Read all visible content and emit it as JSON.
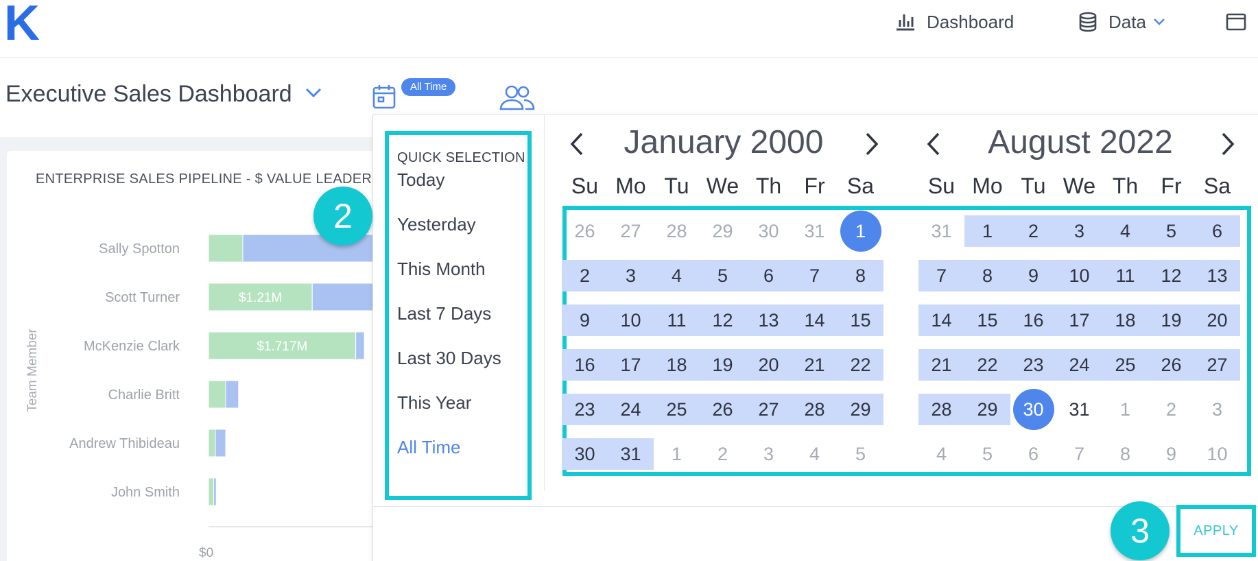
{
  "app": {
    "logo": "K"
  },
  "topnav": {
    "dashboard_label": "Dashboard",
    "data_label": "Data"
  },
  "header": {
    "title": "Executive Sales Dashboard",
    "date_filter_badge": "All Time"
  },
  "chart": {
    "title": "ENTERPRISE SALES PIPELINE - $ VALUE LEADERBO",
    "ylabel": "Team Member",
    "x_tick_0": "$0"
  },
  "chart_data": {
    "type": "bar",
    "title": "ENTERPRISE SALES PIPELINE - $ VALUE LEADERBO",
    "ylabel": "Team Member",
    "categories": [
      "Sally Spotton",
      "Scott Turner",
      "McKenzie Clark",
      "Charlie Britt",
      "Andrew Thibideau",
      "John Smith"
    ],
    "series": [
      {
        "values": [
          0.4,
          1.21,
          1.717,
          0.2,
          0.08,
          0.06
        ],
        "labels": [
          "",
          "$1.21M",
          "$1.717M",
          "",
          "",
          ""
        ]
      },
      {
        "values": [
          2.0,
          0.9,
          0.1,
          0.15,
          0.12,
          0.03
        ]
      }
    ],
    "colors": [
      "#b6e3bf",
      "#a9c2f2"
    ],
    "xlim": [
      0,
      2.4
    ]
  },
  "picker": {
    "quick_heading": "QUICK SELECTION",
    "quick_items": [
      "Today",
      "Yesterday",
      "This Month",
      "Last 7 Days",
      "Last 30 Days",
      "This Year",
      "All Time"
    ],
    "active_item": "All Time",
    "weekdays": [
      "Su",
      "Mo",
      "Tu",
      "We",
      "Th",
      "Fr",
      "Sa"
    ],
    "months": [
      {
        "title": "January 2000",
        "weeks": [
          [
            "26",
            "27",
            "28",
            "29",
            "30",
            "31",
            "1"
          ],
          [
            "2",
            "3",
            "4",
            "5",
            "6",
            "7",
            "8"
          ],
          [
            "9",
            "10",
            "11",
            "12",
            "13",
            "14",
            "15"
          ],
          [
            "16",
            "17",
            "18",
            "19",
            "20",
            "21",
            "22"
          ],
          [
            "23",
            "24",
            "25",
            "26",
            "27",
            "28",
            "29"
          ],
          [
            "30",
            "31",
            "1",
            "2",
            "3",
            "4",
            "5"
          ]
        ]
      },
      {
        "title": "August 2022",
        "weeks": [
          [
            "31",
            "1",
            "2",
            "3",
            "4",
            "5",
            "6"
          ],
          [
            "7",
            "8",
            "9",
            "10",
            "11",
            "12",
            "13"
          ],
          [
            "14",
            "15",
            "16",
            "17",
            "18",
            "19",
            "20"
          ],
          [
            "21",
            "22",
            "23",
            "24",
            "25",
            "26",
            "27"
          ],
          [
            "28",
            "29",
            "30",
            "31",
            "1",
            "2",
            "3"
          ],
          [
            "4",
            "5",
            "6",
            "7",
            "8",
            "9",
            "10"
          ]
        ]
      }
    ],
    "apply_label": "APPLY"
  },
  "callouts": {
    "step2": "2",
    "step3": "3"
  },
  "colors": {
    "accent": "#4f86ec",
    "highlight": "#14c8d2",
    "range": "#cbd9fb"
  }
}
